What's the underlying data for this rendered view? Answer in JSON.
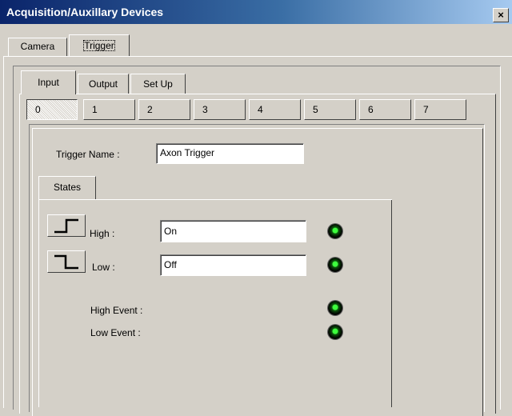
{
  "window": {
    "title": "Acquisition/Auxillary Devices",
    "close_glyph": "×"
  },
  "outer_tabs": [
    {
      "label": "Camera"
    },
    {
      "label": "Trigger"
    }
  ],
  "inner_tabs": [
    {
      "label": "Input"
    },
    {
      "label": "Output"
    },
    {
      "label": "Set Up"
    }
  ],
  "channels": [
    "0",
    "1",
    "2",
    "3",
    "4",
    "5",
    "6",
    "7"
  ],
  "selected_channel": "0",
  "trigger": {
    "name_label": "Trigger Name :",
    "name_value": "Axon Trigger"
  },
  "states_tab": {
    "label": "States"
  },
  "states": {
    "high_label": "High :",
    "high_value": "On",
    "low_label": "Low :",
    "low_value": "Off",
    "high_event_label": "High Event :",
    "low_event_label": "Low Event :"
  },
  "icons": {
    "rising_edge": "rising-edge-icon",
    "falling_edge": "falling-edge-icon",
    "led": "green-led-icon"
  },
  "colors": {
    "title_gradient_start": "#0a246a",
    "title_gradient_end": "#a6caf0",
    "face": "#d4d0c8",
    "led_on": "#3dff3d"
  }
}
